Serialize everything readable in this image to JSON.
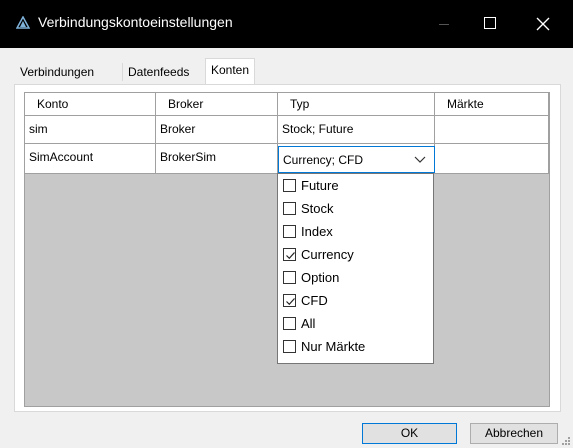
{
  "window": {
    "title": "Verbindungskontoeinstellungen",
    "accent_color": "#0078d7",
    "titlebar_color": "#000000"
  },
  "tabs": [
    {
      "label": "Verbindungen",
      "selected": false
    },
    {
      "label": "Datenfeeds",
      "selected": false
    },
    {
      "label": "Konten",
      "selected": true
    }
  ],
  "grid": {
    "columns": [
      "Konto",
      "Broker",
      "Typ",
      "Märkte"
    ],
    "rows": [
      {
        "konto": "sim",
        "broker": "Broker",
        "typ": "Stock; Future",
        "maerkte": ""
      },
      {
        "konto": "SimAccount",
        "broker": "BrokerSim",
        "typ": "Currency; CFD",
        "maerkte": ""
      }
    ]
  },
  "dropdown": {
    "current_value": "Currency; CFD",
    "options": [
      {
        "label": "Future",
        "checked": false
      },
      {
        "label": "Stock",
        "checked": false
      },
      {
        "label": "Index",
        "checked": false
      },
      {
        "label": "Currency",
        "checked": true
      },
      {
        "label": "Option",
        "checked": false
      },
      {
        "label": "CFD",
        "checked": true
      },
      {
        "label": "All",
        "checked": false
      },
      {
        "label": "Nur Märkte",
        "checked": false
      }
    ]
  },
  "buttons": {
    "ok_label": "OK",
    "cancel_label": "Abbrechen"
  }
}
